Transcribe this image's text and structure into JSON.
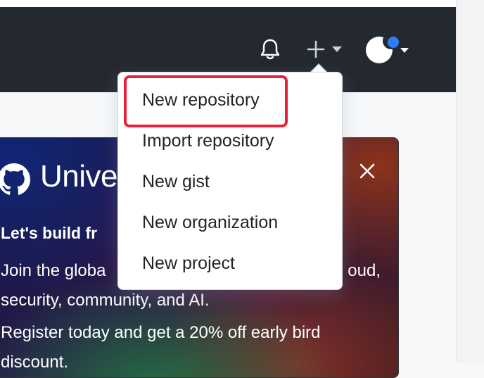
{
  "header": {
    "icons": {
      "notifications": "bell-icon",
      "create": "plus-icon",
      "caret": "triangle-down-icon"
    },
    "avatar": {
      "status_dot_color": "#2f7df6"
    }
  },
  "create_menu": {
    "items": [
      {
        "label": "New repository"
      },
      {
        "label": "Import repository"
      },
      {
        "label": "New gist"
      },
      {
        "label": "New organization"
      },
      {
        "label": "New project"
      }
    ],
    "highlight_color": "#e8203a"
  },
  "banner": {
    "title": "Unive",
    "heading": "Let's build fr",
    "body_line1_left": "Join the globa",
    "body_line1_right": "oud,",
    "body_line2": "security, community, and AI.",
    "body_para2": "Register today and get a 20% off early bird discount."
  },
  "colors": {
    "header_bg": "#24292f",
    "page_bg": "#f6f8fa",
    "text": "#1f2328"
  }
}
